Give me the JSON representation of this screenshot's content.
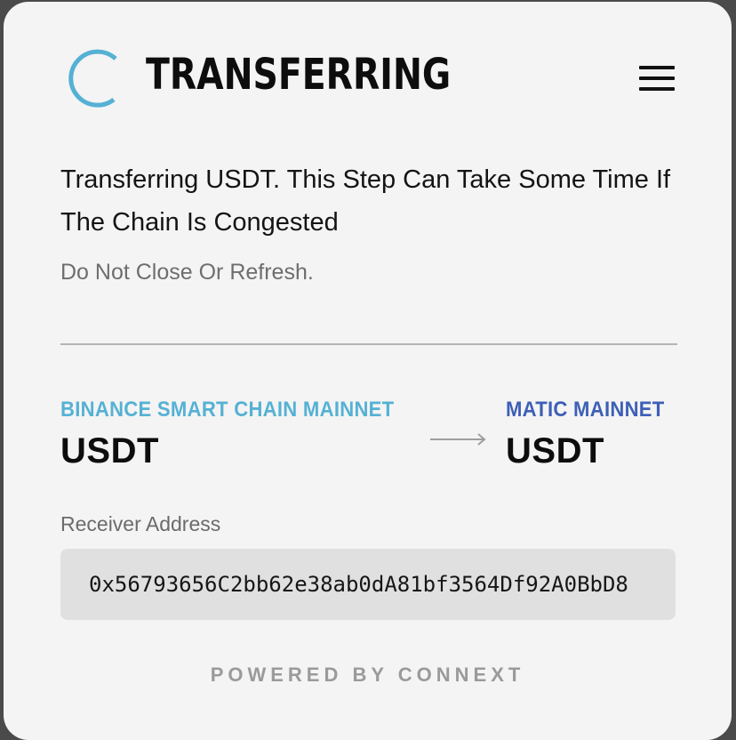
{
  "header": {
    "title": "TRANSFERRING",
    "spinner_icon": "loading-spinner-icon",
    "menu_icon": "hamburger-menu-icon"
  },
  "status": {
    "message": "Transferring USDT. This Step Can Take Some Time If The Chain Is Congested",
    "warning": "Do Not Close Or Refresh."
  },
  "transfer": {
    "from": {
      "chain": "BINANCE SMART CHAIN MAINNET",
      "token": "USDT"
    },
    "to": {
      "chain": "MATIC MAINNET",
      "token": "USDT"
    },
    "arrow_icon": "arrow-right-icon"
  },
  "receiver": {
    "label": "Receiver Address",
    "address": "0x56793656C2bb62e38ab0dA81bf3564Df92A0BbD8"
  },
  "footer": {
    "powered_by": "POWERED BY CONNEXT"
  },
  "colors": {
    "background": "#f4f4f4",
    "spinner": "#55b1d4",
    "from_chain": "#55b1d4",
    "to_chain": "#3d5fb6",
    "address_box": "#e0e0e0"
  }
}
